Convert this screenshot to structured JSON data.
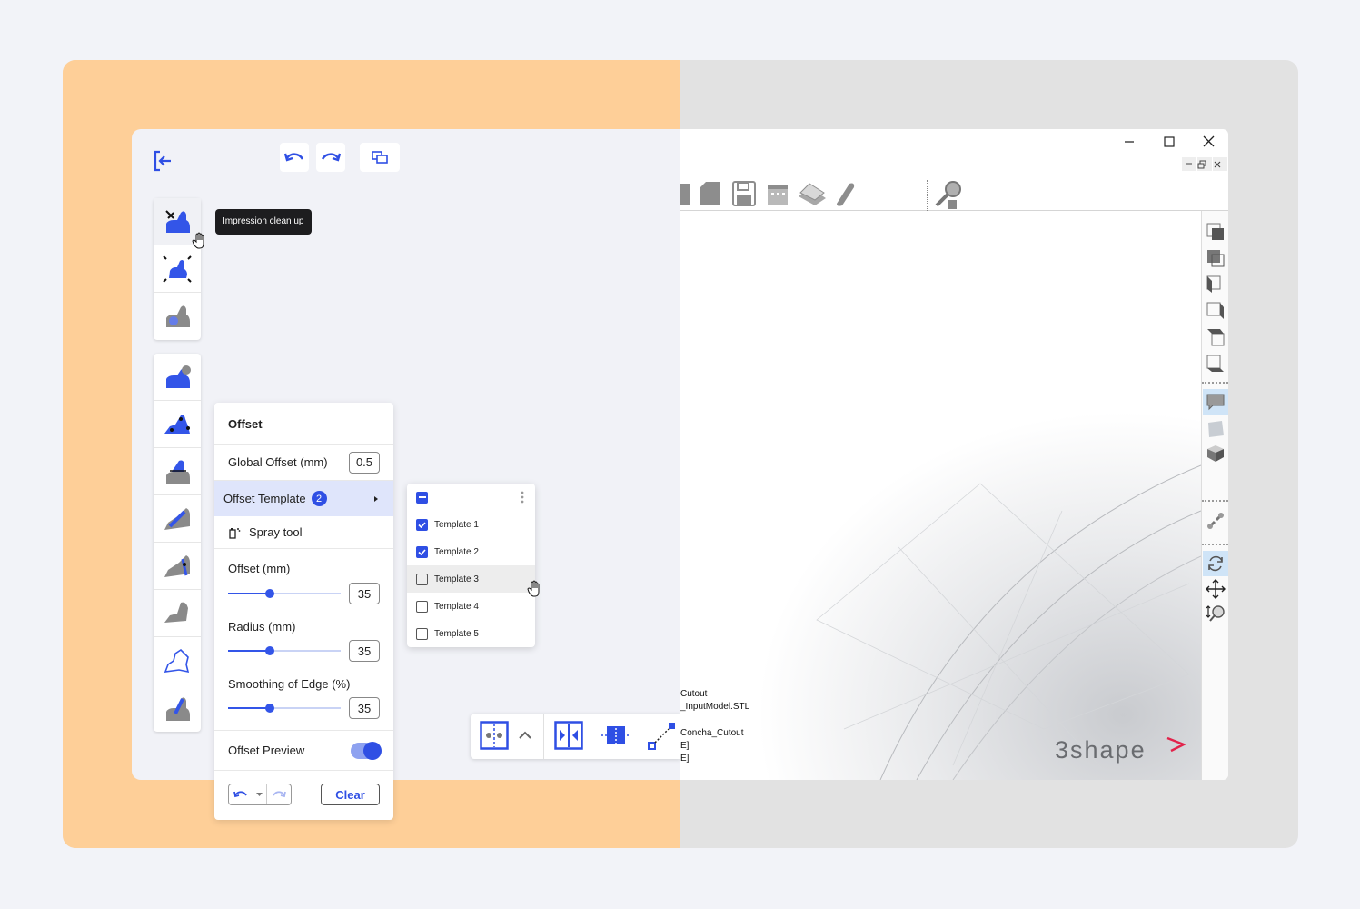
{
  "tooltip": "Impression clean up",
  "panel": {
    "title": "Offset",
    "global_offset_label": "Global Offset (mm)",
    "global_offset_value": "0.5",
    "offset_template_label": "Offset Template",
    "offset_template_count": "2",
    "spray_tool_label": "Spray tool",
    "offset_label": "Offset (mm)",
    "offset_value": "35",
    "radius_label": "Radius (mm)",
    "radius_value": "35",
    "smoothing_label": "Smoothing of Edge (%)",
    "smoothing_value": "35",
    "slider_fraction": 0.37,
    "preview_label": "Offset Preview",
    "preview_on": true,
    "clear_label": "Clear"
  },
  "templates": [
    {
      "label": "Template 1",
      "checked": true
    },
    {
      "label": "Template 2",
      "checked": true
    },
    {
      "label": "Template 3",
      "checked": false
    },
    {
      "label": "Template 4",
      "checked": false
    },
    {
      "label": "Template 5",
      "checked": false
    }
  ],
  "legacy": {
    "info_lines": [
      "Cutout",
      "_InputModel.STL",
      "",
      "Concha_Cutout",
      "E]",
      "E]"
    ],
    "brand": "3shape"
  },
  "colors": {
    "accent": "#2f4fe4",
    "left_backdrop": "#fecf98",
    "right_backdrop": "#e2e2e2"
  }
}
